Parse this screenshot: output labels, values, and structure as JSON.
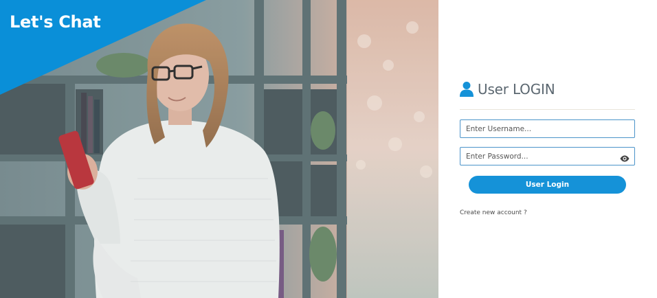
{
  "brand": {
    "title": "Let's Chat",
    "color": "#0a8fd8"
  },
  "hero_image": {
    "icon": "woman-with-phone-photo"
  },
  "login": {
    "icon": "user-icon",
    "title": "User LOGIN",
    "username_placeholder": "Enter Username...",
    "password_placeholder": "Enter Password...",
    "password_toggle_icon": "eye-icon",
    "submit_label": "User Login",
    "create_account_label": "Create new account ?",
    "accent_color": "#1592d8"
  }
}
